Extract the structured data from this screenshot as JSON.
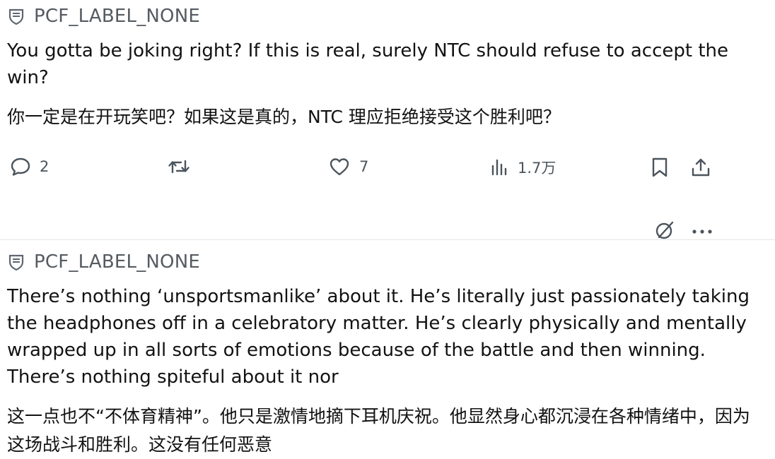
{
  "posts": [
    {
      "author": "PCF_LABEL_NONE",
      "text_en": "You gotta be joking right? If this is real, surely NTC should refuse to accept the win?",
      "text_cn": "你一定是在开玩笑吧？如果这是真的，NTC 理应拒绝接受这个胜利吧？",
      "stats": {
        "replies": "2",
        "likes": "7",
        "views": "1.7万"
      }
    },
    {
      "author": "PCF_LABEL_NONE",
      "text_en": "There’s nothing ‘unsportsmanlike’ about it. He’s literally just passionately taking the headphones off in a celebratory matter. He’s clearly physically and mentally wrapped up in all sorts of emotions because of the battle and then winning. There’s nothing spiteful about it nor",
      "text_cn": "这一点也不“不体育精神”。他只是激情地摘下耳机庆祝。他显然身心都沉浸在各种情绪中，因为这场战斗和胜利。这没有任何恶意"
    }
  ],
  "icons": {
    "author_badge": "shield-label-icon",
    "reply": "speech-bubble-icon",
    "repost": "repost-arrows-icon",
    "like": "heart-icon",
    "views": "bar-chart-icon",
    "bookmark": "bookmark-icon",
    "share": "share-upload-icon",
    "grok": "slashed-circle-icon",
    "more": "more-dots-icon"
  }
}
